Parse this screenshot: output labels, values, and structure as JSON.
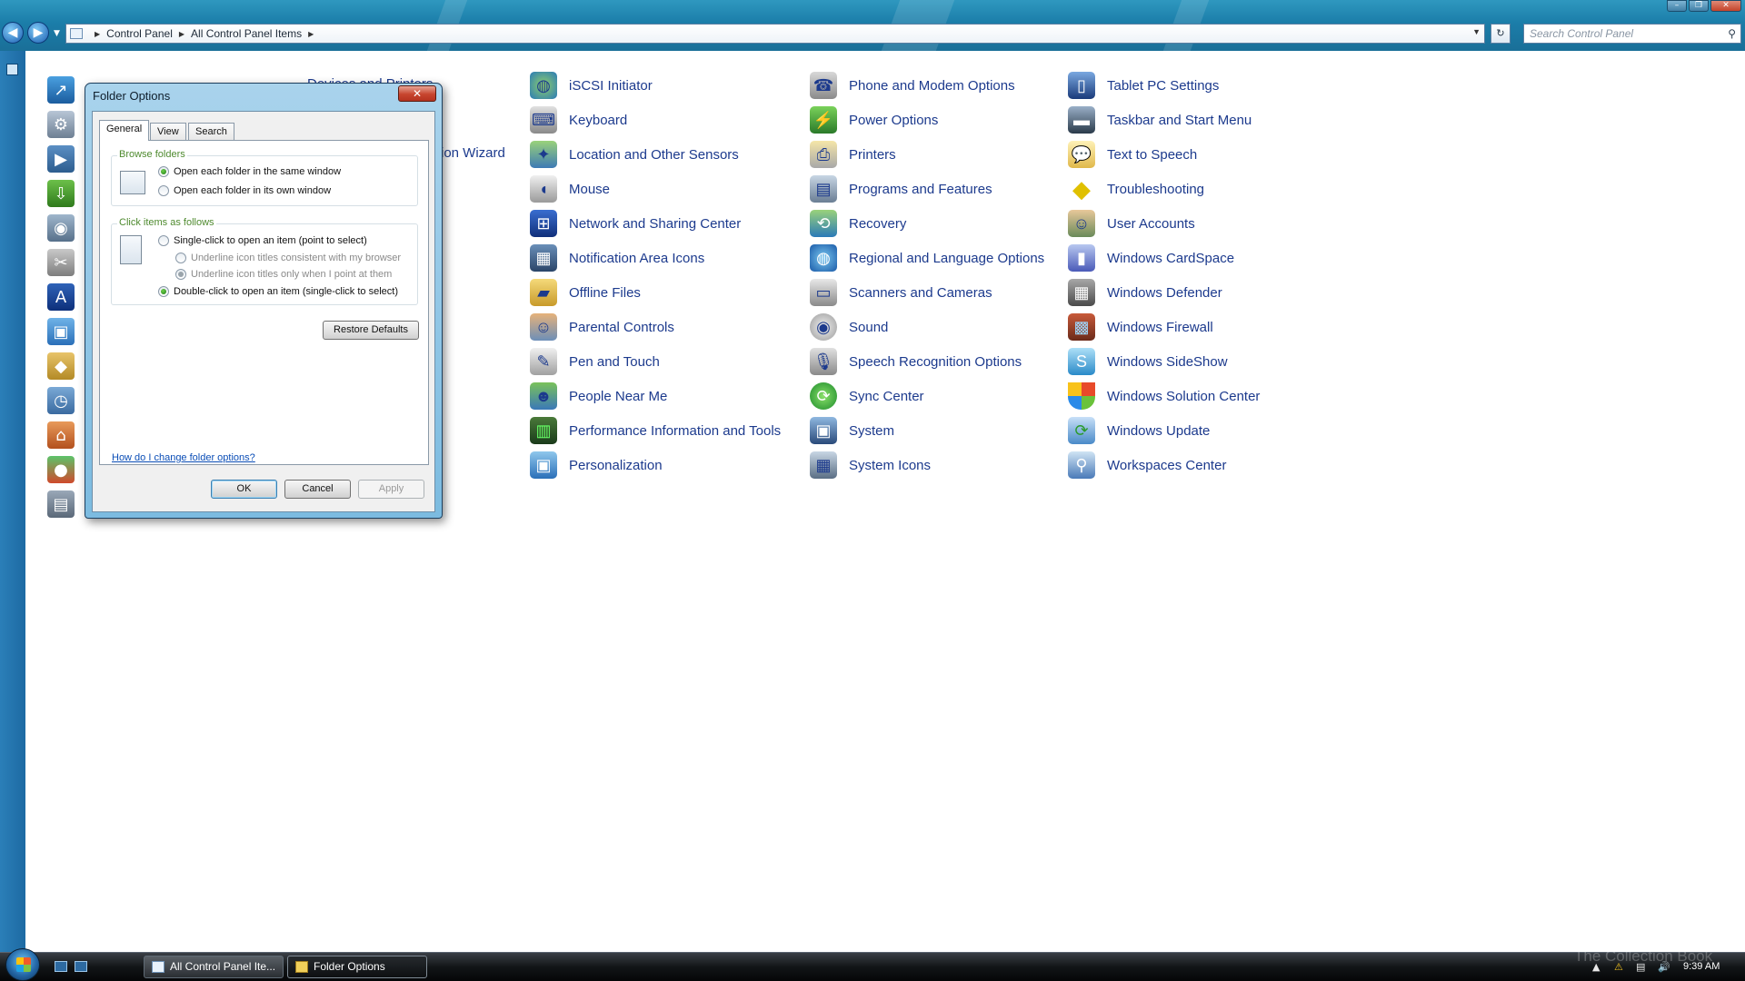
{
  "addressbar": {
    "breadcrumbs": [
      "Control Panel",
      "All Control Panel Items"
    ],
    "search_placeholder": "Search Control Panel"
  },
  "partial_labels": {
    "devices_and_printers": "Devices and Printers",
    "wizard_suffix": "ion Wizard"
  },
  "columns": [
    {
      "items": [
        {
          "label": "iSCSI Initiator",
          "icon": "globe-network-icon"
        },
        {
          "label": "Keyboard",
          "icon": "keyboard-icon"
        },
        {
          "label": "Location and Other Sensors",
          "icon": "sensors-icon"
        },
        {
          "label": "Mouse",
          "icon": "mouse-icon"
        },
        {
          "label": "Network and Sharing Center",
          "icon": "network-icon"
        },
        {
          "label": "Notification Area Icons",
          "icon": "notification-icon"
        },
        {
          "label": "Offline Files",
          "icon": "offline-files-icon"
        },
        {
          "label": "Parental Controls",
          "icon": "parental-controls-icon"
        },
        {
          "label": "Pen and Touch",
          "icon": "pen-icon"
        },
        {
          "label": "People Near Me",
          "icon": "people-icon"
        },
        {
          "label": "Performance Information and Tools",
          "icon": "performance-icon"
        },
        {
          "label": "Personalization",
          "icon": "personalization-icon"
        }
      ]
    },
    {
      "items": [
        {
          "label": "Phone and Modem Options",
          "icon": "phone-icon"
        },
        {
          "label": "Power Options",
          "icon": "power-icon"
        },
        {
          "label": "Printers",
          "icon": "printer-icon"
        },
        {
          "label": "Programs and Features",
          "icon": "programs-icon"
        },
        {
          "label": "Recovery",
          "icon": "recovery-icon"
        },
        {
          "label": "Regional and Language Options",
          "icon": "regional-globe-icon"
        },
        {
          "label": "Scanners and Cameras",
          "icon": "scanner-icon"
        },
        {
          "label": "Sound",
          "icon": "speaker-icon"
        },
        {
          "label": "Speech Recognition Options",
          "icon": "microphone-icon"
        },
        {
          "label": "Sync Center",
          "icon": "sync-icon"
        },
        {
          "label": "System",
          "icon": "system-icon"
        },
        {
          "label": "System Icons",
          "icon": "system-icons-icon"
        }
      ]
    },
    {
      "items": [
        {
          "label": "Tablet PC Settings",
          "icon": "tablet-icon"
        },
        {
          "label": "Taskbar and Start Menu",
          "icon": "taskbar-icon"
        },
        {
          "label": "Text to Speech",
          "icon": "speech-bubble-icon"
        },
        {
          "label": "Troubleshooting",
          "icon": "troubleshooting-icon"
        },
        {
          "label": "User Accounts",
          "icon": "user-accounts-icon"
        },
        {
          "label": "Windows CardSpace",
          "icon": "cardspace-icon"
        },
        {
          "label": "Windows Defender",
          "icon": "defender-icon"
        },
        {
          "label": "Windows Firewall",
          "icon": "firewall-icon"
        },
        {
          "label": "Windows SideShow",
          "icon": "sideshow-icon"
        },
        {
          "label": "Windows Solution Center",
          "icon": "shield-icon"
        },
        {
          "label": "Windows Update",
          "icon": "update-icon"
        },
        {
          "label": "Workspaces Center",
          "icon": "workspaces-icon"
        }
      ]
    }
  ],
  "dialog": {
    "title": "Folder Options",
    "close_glyph": "✕",
    "tabs": [
      "General",
      "View",
      "Search"
    ],
    "browse_group": {
      "legend": "Browse folders",
      "options": [
        "Open each folder in the same window",
        "Open each folder in its own window"
      ],
      "selected": 0
    },
    "click_group": {
      "legend": "Click items as follows",
      "single": "Single-click to open an item (point to select)",
      "underline_browser": "Underline icon titles consistent with my browser",
      "underline_point": "Underline icon titles only when I point at them",
      "double": "Double-click to open an item (single-click to select)"
    },
    "restore_defaults": "Restore Defaults",
    "help_link": "How do I change folder options?",
    "ok": "OK",
    "cancel": "Cancel",
    "apply": "Apply"
  },
  "taskbar": {
    "tasks": [
      "All Control Panel Ite...",
      "Folder Options"
    ],
    "watermark": "The Collection Book",
    "clock": "9:39 AM"
  }
}
